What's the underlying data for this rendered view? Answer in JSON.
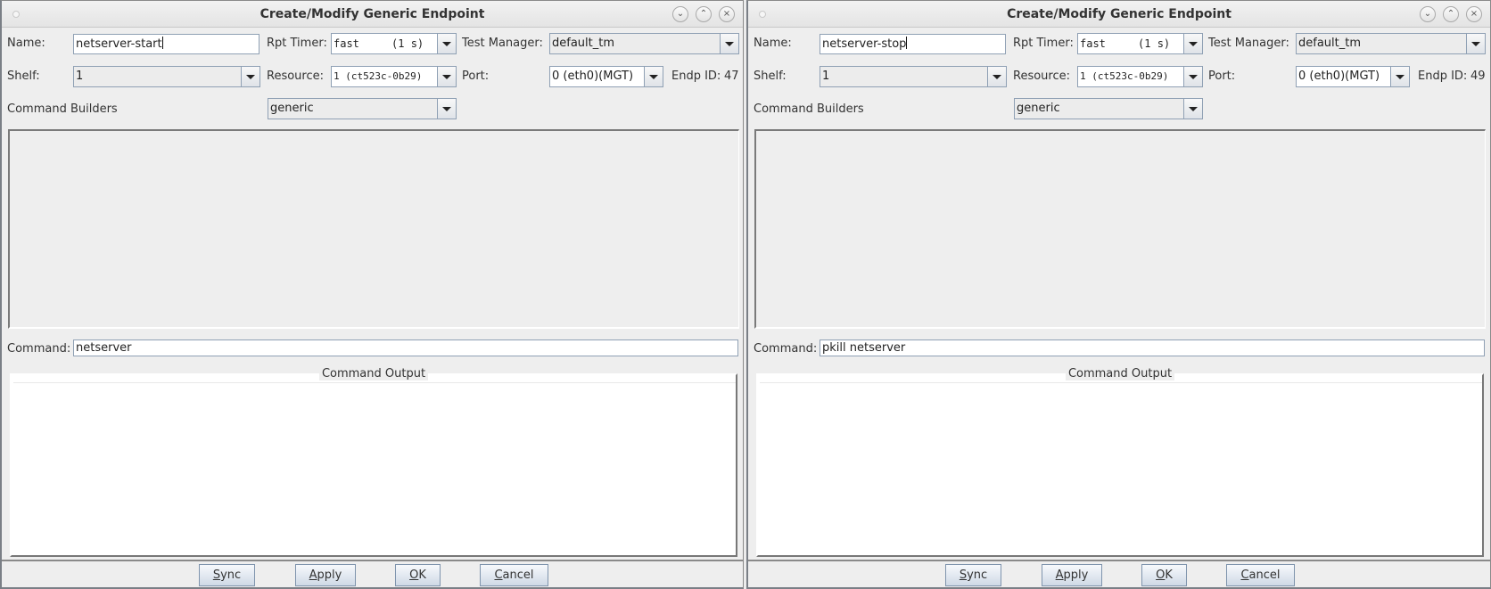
{
  "windows": [
    {
      "title": "Create/Modify Generic Endpoint",
      "titlebar_buttons": {
        "minimize": "⌄",
        "maximize": "⌃",
        "close": "×"
      },
      "labels": {
        "name": "Name:",
        "rpt_timer": "Rpt Timer:",
        "test_manager": "Test Manager:",
        "shelf": "Shelf:",
        "resource": "Resource:",
        "port": "Port:",
        "endp_id": "Endp ID:",
        "command_builders": "Command Builders",
        "command": "Command:",
        "command_output": "Command Output"
      },
      "name": "netserver-start",
      "rpt_timer": "fast     (1 s)",
      "test_manager": "default_tm",
      "shelf": "1",
      "resource": "1 (ct523c-0b29)",
      "port": "0 (eth0)(MGT)",
      "endp_id": "47",
      "command_builder": "generic",
      "command": "netserver",
      "command_output": "",
      "buttons": {
        "sync": {
          "mnemonic": "S",
          "rest": "ync"
        },
        "apply": {
          "mnemonic": "A",
          "rest": "pply"
        },
        "ok": {
          "mnemonic": "O",
          "rest": "K"
        },
        "cancel": {
          "mnemonic": "C",
          "rest": "ancel"
        }
      }
    },
    {
      "title": "Create/Modify Generic Endpoint",
      "titlebar_buttons": {
        "minimize": "⌄",
        "maximize": "⌃",
        "close": "×"
      },
      "labels": {
        "name": "Name:",
        "rpt_timer": "Rpt Timer:",
        "test_manager": "Test Manager:",
        "shelf": "Shelf:",
        "resource": "Resource:",
        "port": "Port:",
        "endp_id": "Endp ID:",
        "command_builders": "Command Builders",
        "command": "Command:",
        "command_output": "Command Output"
      },
      "name": "netserver-stop",
      "rpt_timer": "fast     (1 s)",
      "test_manager": "default_tm",
      "shelf": "1",
      "resource": "1 (ct523c-0b29)",
      "port": "0 (eth0)(MGT)",
      "endp_id": "49",
      "command_builder": "generic",
      "command": "pkill netserver",
      "command_output": "",
      "buttons": {
        "sync": {
          "mnemonic": "S",
          "rest": "ync"
        },
        "apply": {
          "mnemonic": "A",
          "rest": "pply"
        },
        "ok": {
          "mnemonic": "O",
          "rest": "K"
        },
        "cancel": {
          "mnemonic": "C",
          "rest": "ancel"
        }
      }
    }
  ]
}
